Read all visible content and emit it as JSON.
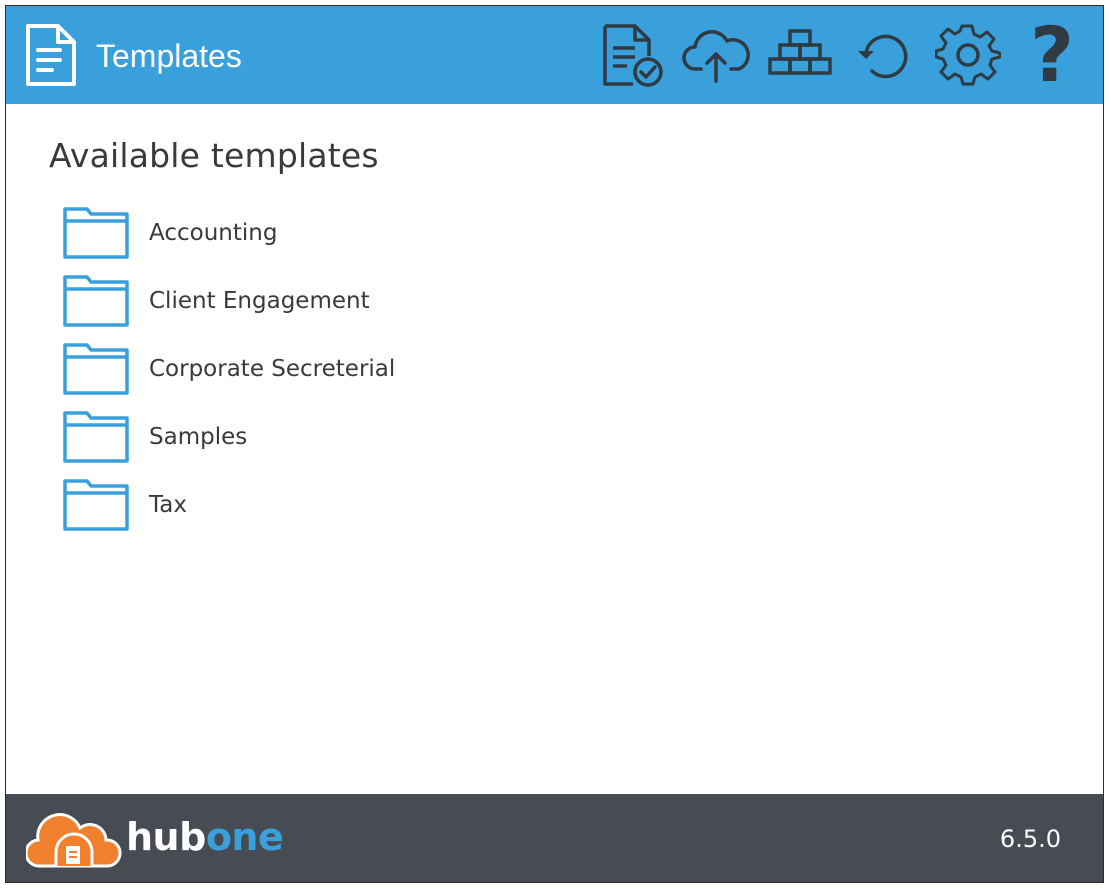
{
  "header": {
    "title": "Templates",
    "app_icon": "document-icon",
    "background_color": "#3aa0dc",
    "toolbar": [
      {
        "name": "document-check-icon"
      },
      {
        "name": "cloud-upload-icon"
      },
      {
        "name": "stacked-blocks-icon"
      },
      {
        "name": "refresh-icon"
      },
      {
        "name": "gear-icon"
      },
      {
        "name": "help-icon",
        "glyph": "?"
      }
    ]
  },
  "main": {
    "heading": "Available templates",
    "folders": [
      {
        "label": "Accounting",
        "icon": "folder-icon"
      },
      {
        "label": "Client Engagement",
        "icon": "folder-icon"
      },
      {
        "label": "Corporate Secreterial",
        "icon": "folder-icon"
      },
      {
        "label": "Samples",
        "icon": "folder-icon"
      },
      {
        "label": "Tax",
        "icon": "folder-icon"
      }
    ],
    "folder_color": "#3aa0dc"
  },
  "footer": {
    "logo": {
      "hub": "hub",
      "one": "one",
      "icon": "cloud-logo-icon",
      "accent": "#f07f2e"
    },
    "version": "6.5.0",
    "background_color": "#474b53"
  }
}
